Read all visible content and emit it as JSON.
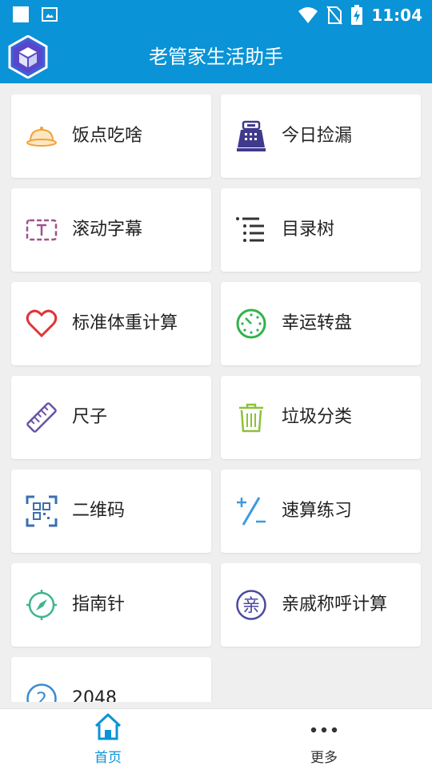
{
  "status_bar": {
    "time": "11:04"
  },
  "app_bar": {
    "title": "老管家生活助手"
  },
  "tools": [
    {
      "label": "饭点吃啥",
      "icon": "food-cloche-icon",
      "color": "#f0a23a"
    },
    {
      "label": "今日捡漏",
      "icon": "cash-register-icon",
      "color": "#3f3a8c"
    },
    {
      "label": "滚动字幕",
      "icon": "marquee-text-icon",
      "color": "#a0528a"
    },
    {
      "label": "目录树",
      "icon": "list-tree-icon",
      "color": "#333333"
    },
    {
      "label": "标准体重计算",
      "icon": "heart-icon",
      "color": "#e03535"
    },
    {
      "label": "幸运转盘",
      "icon": "lucky-wheel-icon",
      "color": "#2fb34a"
    },
    {
      "label": "尺子",
      "icon": "ruler-icon",
      "color": "#6a54a8"
    },
    {
      "label": "垃圾分类",
      "icon": "trash-can-icon",
      "color": "#8dc13a"
    },
    {
      "label": "二维码",
      "icon": "qr-code-icon",
      "color": "#3a6fb0"
    },
    {
      "label": "速算练习",
      "icon": "plus-slash-minus-icon",
      "color": "#3a9be0"
    },
    {
      "label": "指南针",
      "icon": "compass-icon",
      "color": "#3fb58f"
    },
    {
      "label": "亲戚称呼计算",
      "icon": "relative-badge-icon",
      "color": "#4a4aa0",
      "badge": "亲"
    },
    {
      "label": "2048",
      "icon": "number-badge-icon",
      "color": "#3a8ad0",
      "badge": "2"
    }
  ],
  "bottom_nav": [
    {
      "label": "首页",
      "icon": "home-icon",
      "active": true,
      "color": "#0a93d6"
    },
    {
      "label": "更多",
      "icon": "more-dots-icon",
      "active": false,
      "color": "#333333"
    }
  ]
}
